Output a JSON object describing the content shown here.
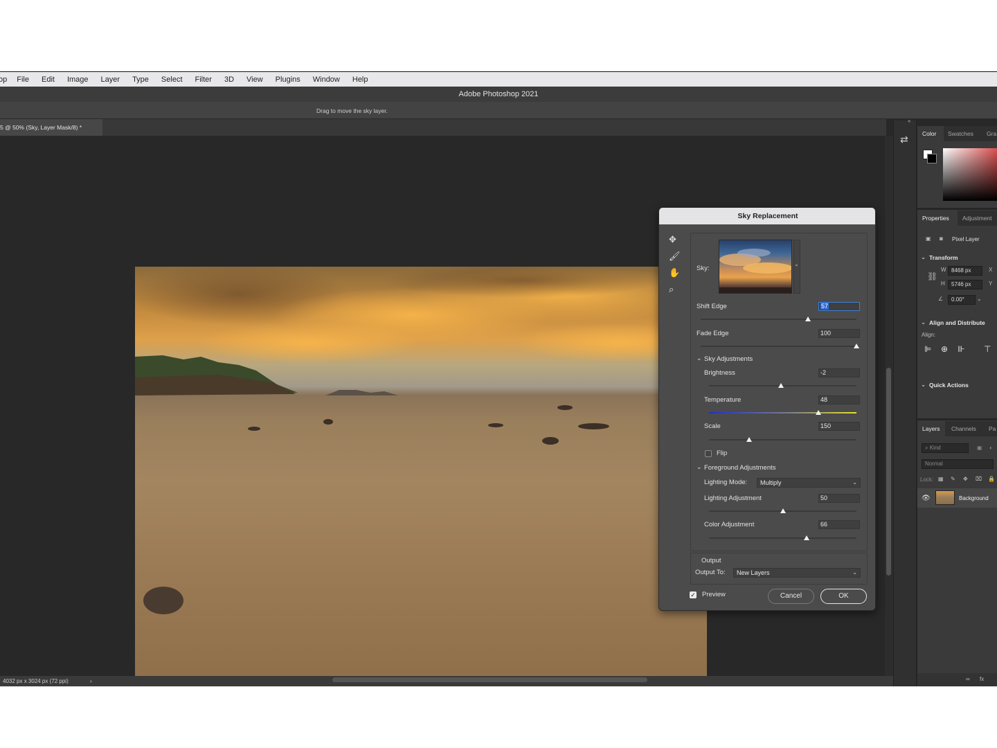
{
  "menu": [
    "op",
    "File",
    "Edit",
    "Image",
    "Layer",
    "Type",
    "Select",
    "Filter",
    "3D",
    "View",
    "Plugins",
    "Window",
    "Help"
  ],
  "app_title": "Adobe Photoshop 2021",
  "options_hint": "Drag to move the sky layer.",
  "doc_tab": "5 @ 50% (Sky, Layer Mask/8) *",
  "status": {
    "dimensions": "4032 px x 3024 px (72 ppi)",
    "arrow": "›"
  },
  "right_panels": {
    "color_tabs": [
      "Color",
      "Swatches",
      "Gra"
    ],
    "properties_tabs": [
      "Properties",
      "Adjustment"
    ],
    "pixel_layer": "Pixel Layer",
    "transform": {
      "header": "Transform",
      "w_label": "W",
      "w": "8468 px",
      "h_label": "H",
      "h": "5746 px",
      "x_label": "X",
      "y_label": "Y",
      "angle": "0.00°"
    },
    "align": {
      "header": "Align and Distribute",
      "label": "Align:"
    },
    "quick_actions": "Quick Actions",
    "layers_tabs": [
      "Layers",
      "Channels",
      "Pa"
    ],
    "kind": "Kind",
    "blend": "Normal",
    "lock": "Lock:",
    "layer_name": "Background",
    "footer": [
      "∞",
      "fx"
    ]
  },
  "dialog": {
    "title": "Sky Replacement",
    "sky_label": "Sky:",
    "shift_edge": {
      "label": "Shift Edge",
      "value": "57",
      "percent": 69
    },
    "fade_edge": {
      "label": "Fade Edge",
      "value": "100",
      "percent": 100
    },
    "sky_adjustments": "Sky Adjustments",
    "brightness": {
      "label": "Brightness",
      "value": "-2",
      "percent": 49
    },
    "temperature": {
      "label": "Temperature",
      "value": "48",
      "percent": 74
    },
    "scale": {
      "label": "Scale",
      "value": "150",
      "percent": 27
    },
    "flip": "Flip",
    "foreground_adjustments": "Foreground Adjustments",
    "lighting_mode": {
      "label": "Lighting Mode:",
      "value": "Multiply"
    },
    "lighting_adjustment": {
      "label": "Lighting Adjustment",
      "value": "50",
      "percent": 50
    },
    "color_adjustment": {
      "label": "Color Adjustment",
      "value": "66",
      "percent": 66
    },
    "output": "Output",
    "output_to": {
      "label": "Output To:",
      "value": "New Layers"
    },
    "preview": "Preview",
    "cancel": "Cancel",
    "ok": "OK"
  }
}
